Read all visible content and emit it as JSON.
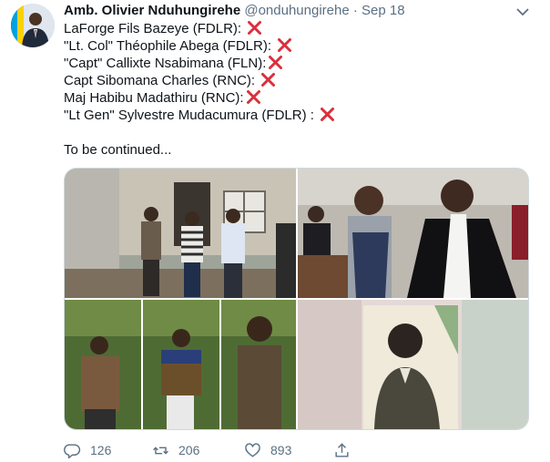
{
  "tweet": {
    "author_name": "Amb. Olivier Nduhungirehe",
    "handle": "@onduhungirehe",
    "separator": "·",
    "date": "Sep 18",
    "lines": [
      "LaForge Fils Bazeye (FDLR): ",
      "\"Lt. Col\" Théophile Abega (FDLR): ",
      "\"Capt\" Callixte Nsabimana (FLN):",
      "Capt Sibomana Charles (RNC): ",
      "Maj Habibu Madathiru (RNC):",
      "\"Lt Gen\" Sylvestre Mudacumura (FDLR) : "
    ],
    "continued": "To be continued..."
  },
  "actions": {
    "replies": "126",
    "retweets": "206",
    "likes": "893"
  },
  "colors": {
    "cross": "#d9303c",
    "secondary_text": "#5b7083",
    "primary_text": "#0f1419"
  },
  "icons": {
    "cross": "cross-mark-icon",
    "reply": "reply-icon",
    "retweet": "retweet-icon",
    "like": "heart-icon",
    "share": "share-icon",
    "more": "chevron-down-icon"
  }
}
